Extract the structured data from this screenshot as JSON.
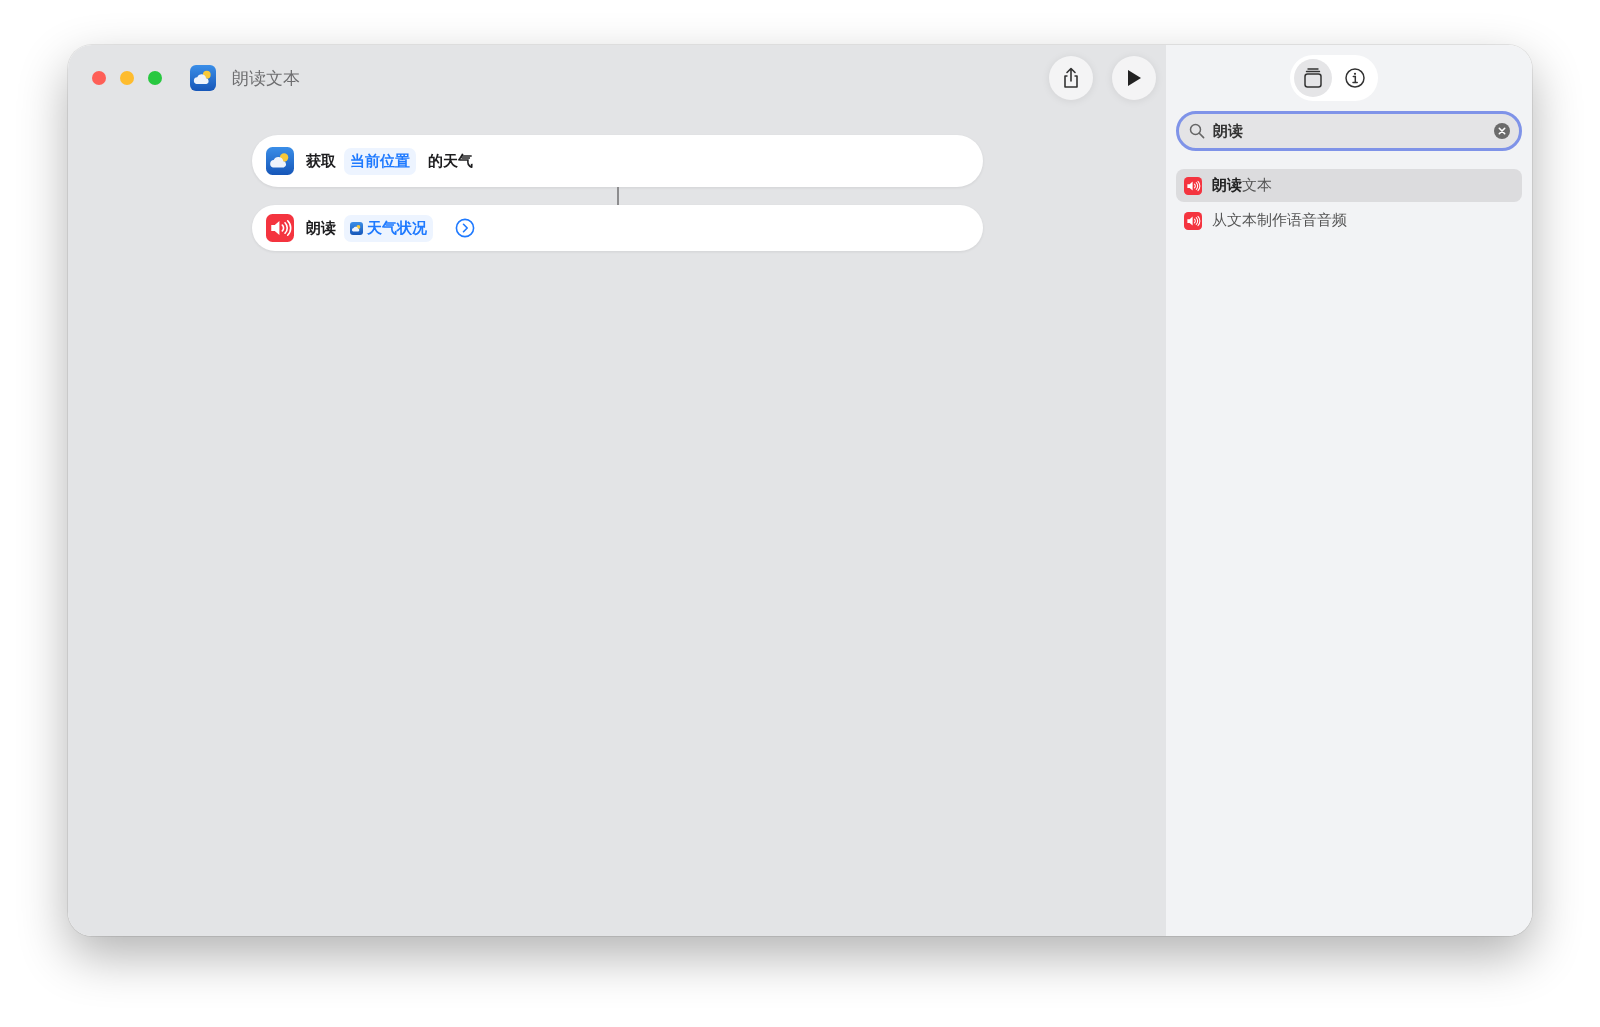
{
  "window": {
    "title": "朗读文本"
  },
  "actions": [
    {
      "kind": "weather",
      "parts": [
        {
          "kind": "text",
          "text": "获取"
        },
        {
          "kind": "token",
          "text": "当前位置"
        },
        {
          "kind": "text",
          "text": "的天气"
        }
      ],
      "expandable": false
    },
    {
      "kind": "speak",
      "parts": [
        {
          "kind": "text",
          "text": "朗读"
        },
        {
          "kind": "variable",
          "text": "天气状况"
        }
      ],
      "expandable": true
    }
  ],
  "sidebar": {
    "tabs": [
      {
        "kind": "library",
        "selected": true
      },
      {
        "kind": "info",
        "selected": false
      }
    ],
    "search": {
      "value": "朗读"
    },
    "results": [
      {
        "label": "**朗读**文本",
        "selected": true
      },
      {
        "label": "从文本制作语音音频",
        "selected": false
      }
    ]
  }
}
